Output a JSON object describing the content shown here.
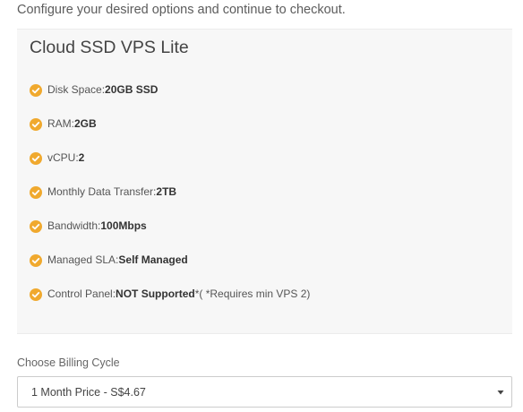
{
  "intro_text": "Configure your desired options and continue to checkout.",
  "product": {
    "name": "Cloud SSD VPS Lite",
    "features": [
      {
        "label": "Disk Space: ",
        "value": "20GB SSD",
        "suffix": ""
      },
      {
        "label": "RAM: ",
        "value": "2GB",
        "suffix": ""
      },
      {
        "label": "vCPU: ",
        "value": "2",
        "suffix": ""
      },
      {
        "label": "Monthly Data Transfer: ",
        "value": "2TB",
        "suffix": ""
      },
      {
        "label": "Bandwidth: ",
        "value": "100Mbps",
        "suffix": ""
      },
      {
        "label": "Managed SLA:",
        "value": "Self Managed",
        "suffix": ""
      },
      {
        "label": "Control Panel: ",
        "value": "NOT Supported",
        "suffix": " *( *Requires min VPS 2)"
      }
    ]
  },
  "billing": {
    "label": "Choose Billing Cycle",
    "selected": "1 Month Price - S$4.67"
  },
  "icons": {
    "feature_bullet": "check-circle-icon",
    "select_arrow": "chevron-down-icon"
  },
  "colors": {
    "check_icon": "#f0a92e",
    "panel_background": "#f7f7f7"
  }
}
